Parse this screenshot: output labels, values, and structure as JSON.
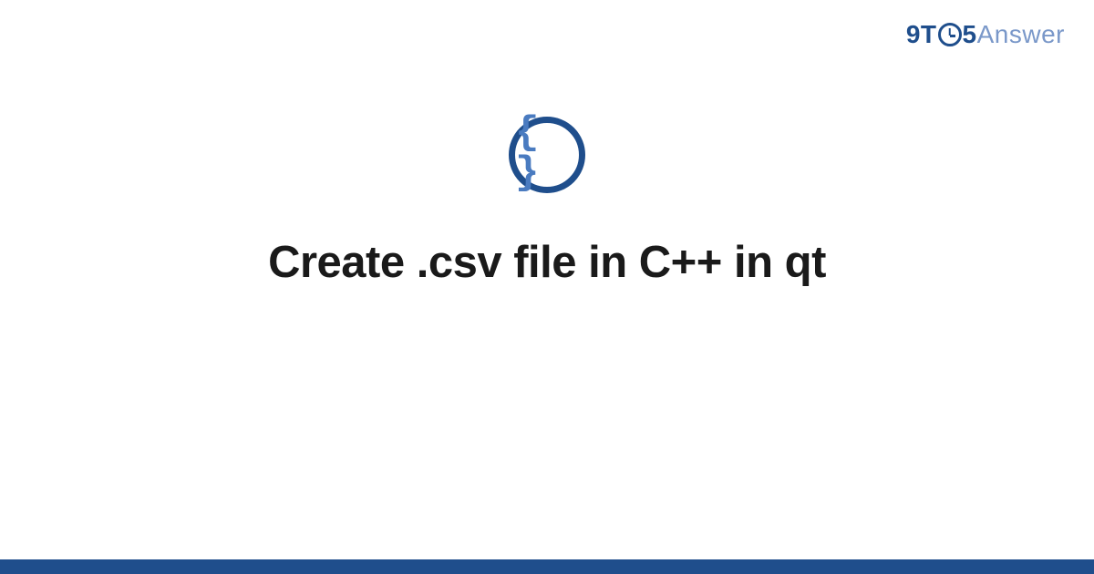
{
  "logo": {
    "part1": "9T",
    "part2": "5",
    "part3": "Answer"
  },
  "icon": {
    "glyph": "{ }"
  },
  "title": "Create .csv file in C++ in qt",
  "colors": {
    "brand_dark": "#1f4e8c",
    "brand_light": "#7a98c9",
    "brace": "#4a7bc0"
  }
}
